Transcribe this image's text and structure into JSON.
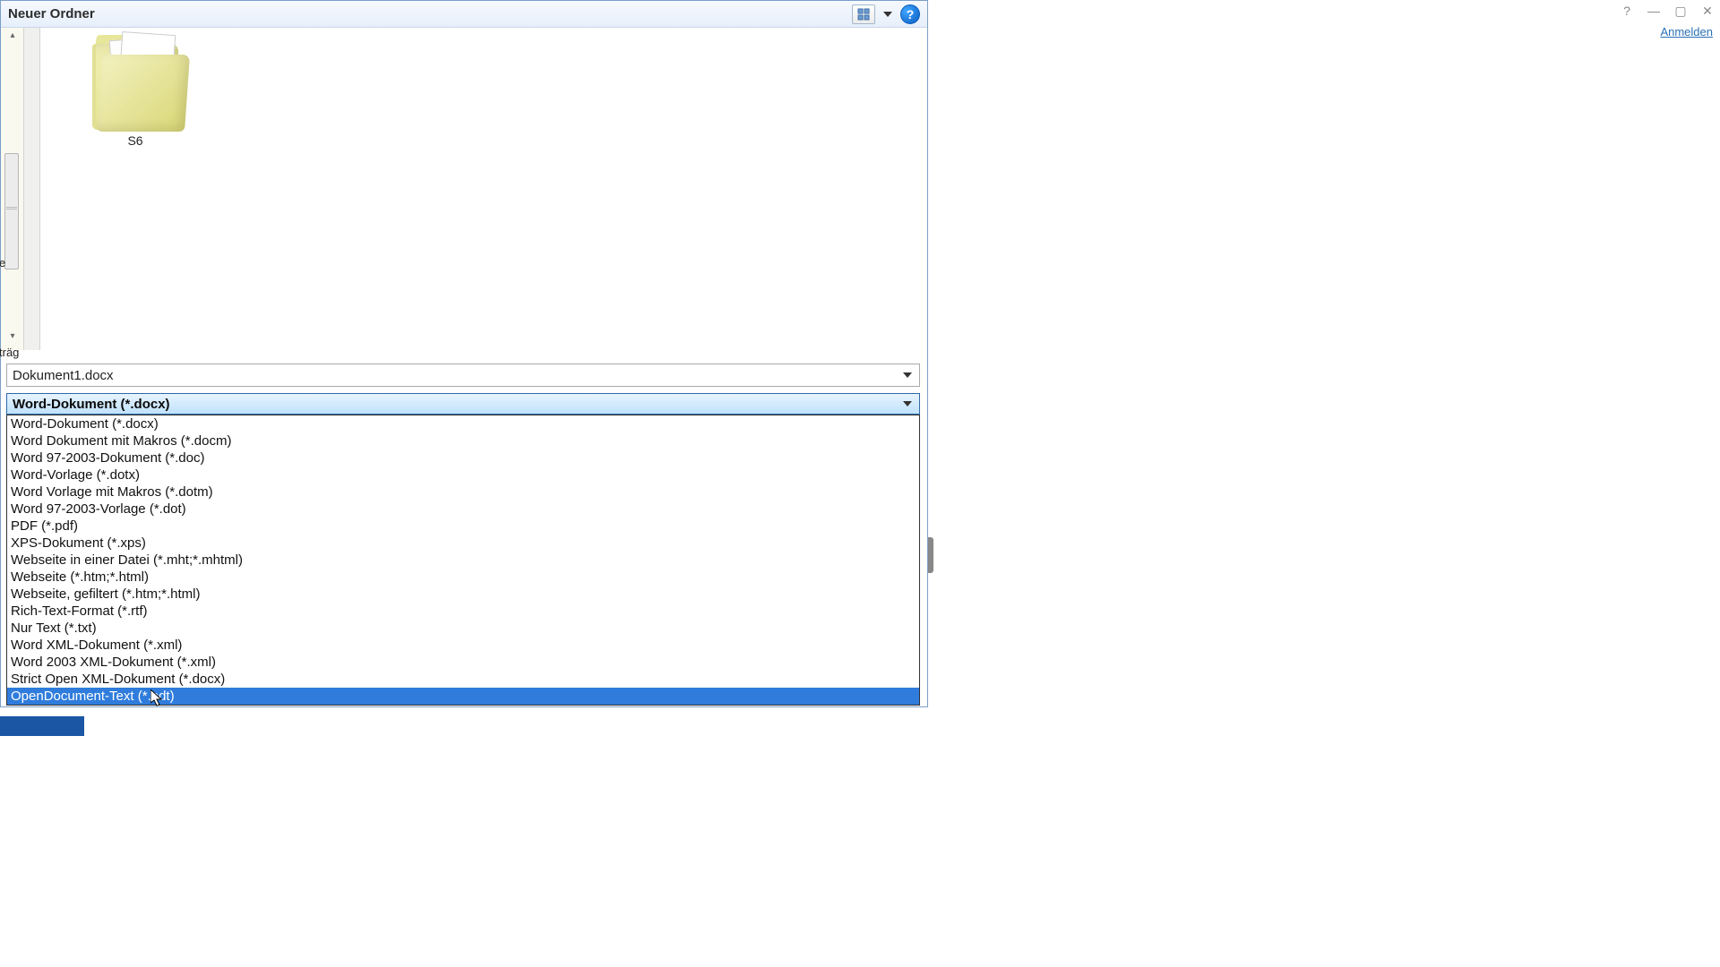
{
  "titlebar": {
    "title": "Neuer Ordner"
  },
  "signin": "Anmelden",
  "folder": {
    "name": "S6"
  },
  "left_partial_labels": {
    "a": "e",
    "b": "träg"
  },
  "filename": {
    "value": "Dokument1.docx"
  },
  "filetype": {
    "selected": "Word-Dokument (*.docx)",
    "options": [
      "Word-Dokument (*.docx)",
      "Word Dokument mit Makros (*.docm)",
      "Word 97-2003-Dokument (*.doc)",
      "Word-Vorlage (*.dotx)",
      "Word Vorlage mit Makros (*.dotm)",
      "Word 97-2003-Vorlage (*.dot)",
      "PDF (*.pdf)",
      "XPS-Dokument (*.xps)",
      "Webseite in einer Datei (*.mht;*.mhtml)",
      "Webseite (*.htm;*.html)",
      "Webseite, gefiltert (*.htm;*.html)",
      "Rich-Text-Format (*.rtf)",
      "Nur Text (*.txt)",
      "Word XML-Dokument (*.xml)",
      "Word 2003 XML-Dokument (*.xml)",
      "Strict Open XML-Dokument (*.docx)",
      "OpenDocument-Text (*.odt)"
    ],
    "highlighted_index": 16
  }
}
